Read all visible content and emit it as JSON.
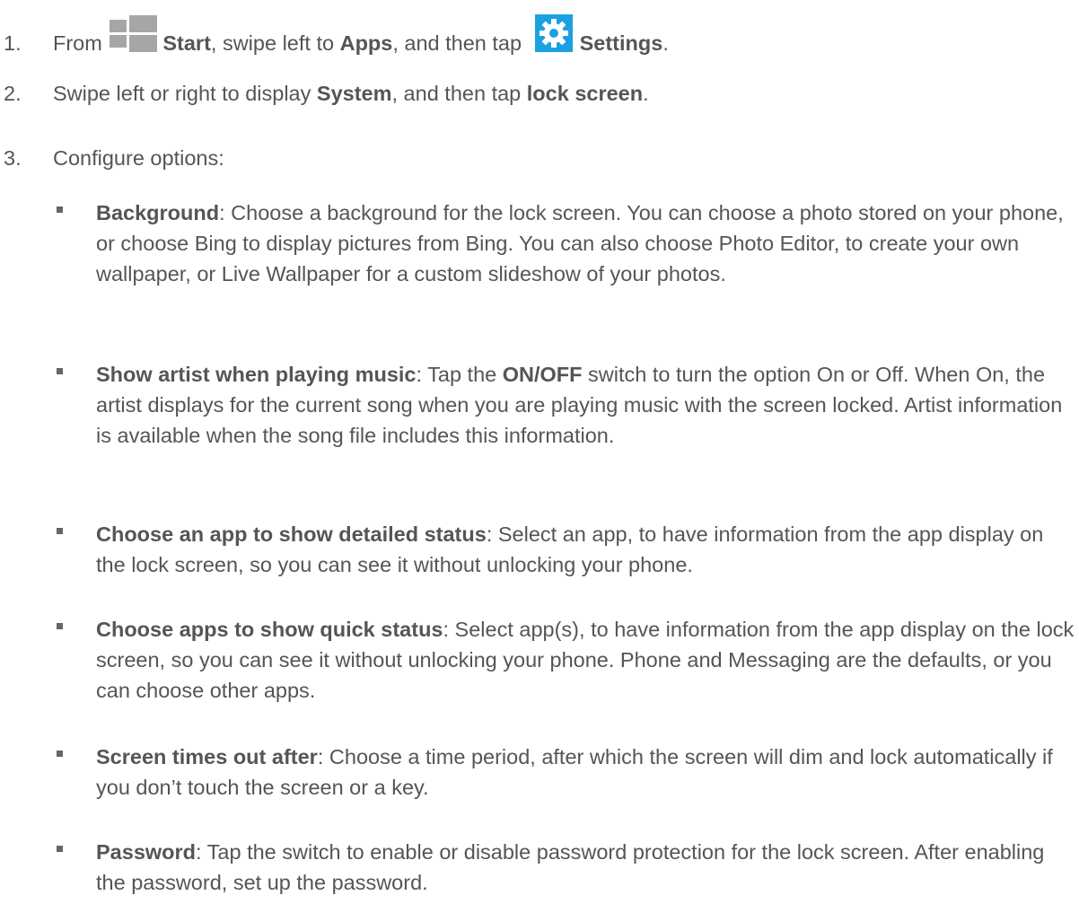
{
  "steps": [
    {
      "number": "1.",
      "text_from": "From",
      "start": "Start",
      "text_mid": ", swipe left to ",
      "apps": "Apps",
      "text_then": ", and then tap",
      "settings": "Settings",
      "text_end": "."
    },
    {
      "number": "2.",
      "text_a": "Swipe left or right to display ",
      "system": "System",
      "text_b": ", and then tap ",
      "lock_screen": "lock screen",
      "text_c": "."
    },
    {
      "number": "3.",
      "text": "Configure options:"
    }
  ],
  "options": [
    {
      "term": "Background",
      "desc": ": Choose a background for the lock screen. You can choose a photo stored on your phone, or choose Bing to display pictures from Bing. You can also choose Photo Editor, to create your own wallpaper, or Live Wallpaper for a custom slideshow of your photos."
    },
    {
      "term": "Show artist when playing music",
      "desc_a": ": Tap the ",
      "switch": "ON/OFF",
      "desc_b": " switch to turn the option On or Off. When On, the artist displays for the current song when you are playing music with the screen locked. Artist information is available when the song file includes this information."
    },
    {
      "term": "Choose an app to show detailed status",
      "desc": ": Select an app, to have information from the app display on the lock screen, so you can see it without unlocking your phone."
    },
    {
      "term": "Choose apps to show quick status",
      "desc": ": Select app(s), to have information from the app display on the lock screen, so you can see it without unlocking your phone. Phone and Messaging are the defaults, or you can choose other apps."
    },
    {
      "term": "Screen times out after",
      "desc": ": Choose a time period, after which the screen will dim and lock automatically if you don’t touch the screen or a key."
    },
    {
      "term": "Password",
      "desc": ": Tap the switch to enable or disable password protection for the lock screen. After enabling the password, set up the password."
    }
  ],
  "colors": {
    "text": "#555555",
    "start_icon": "#a6a6a6",
    "settings_tile": "#1ba1e2"
  }
}
